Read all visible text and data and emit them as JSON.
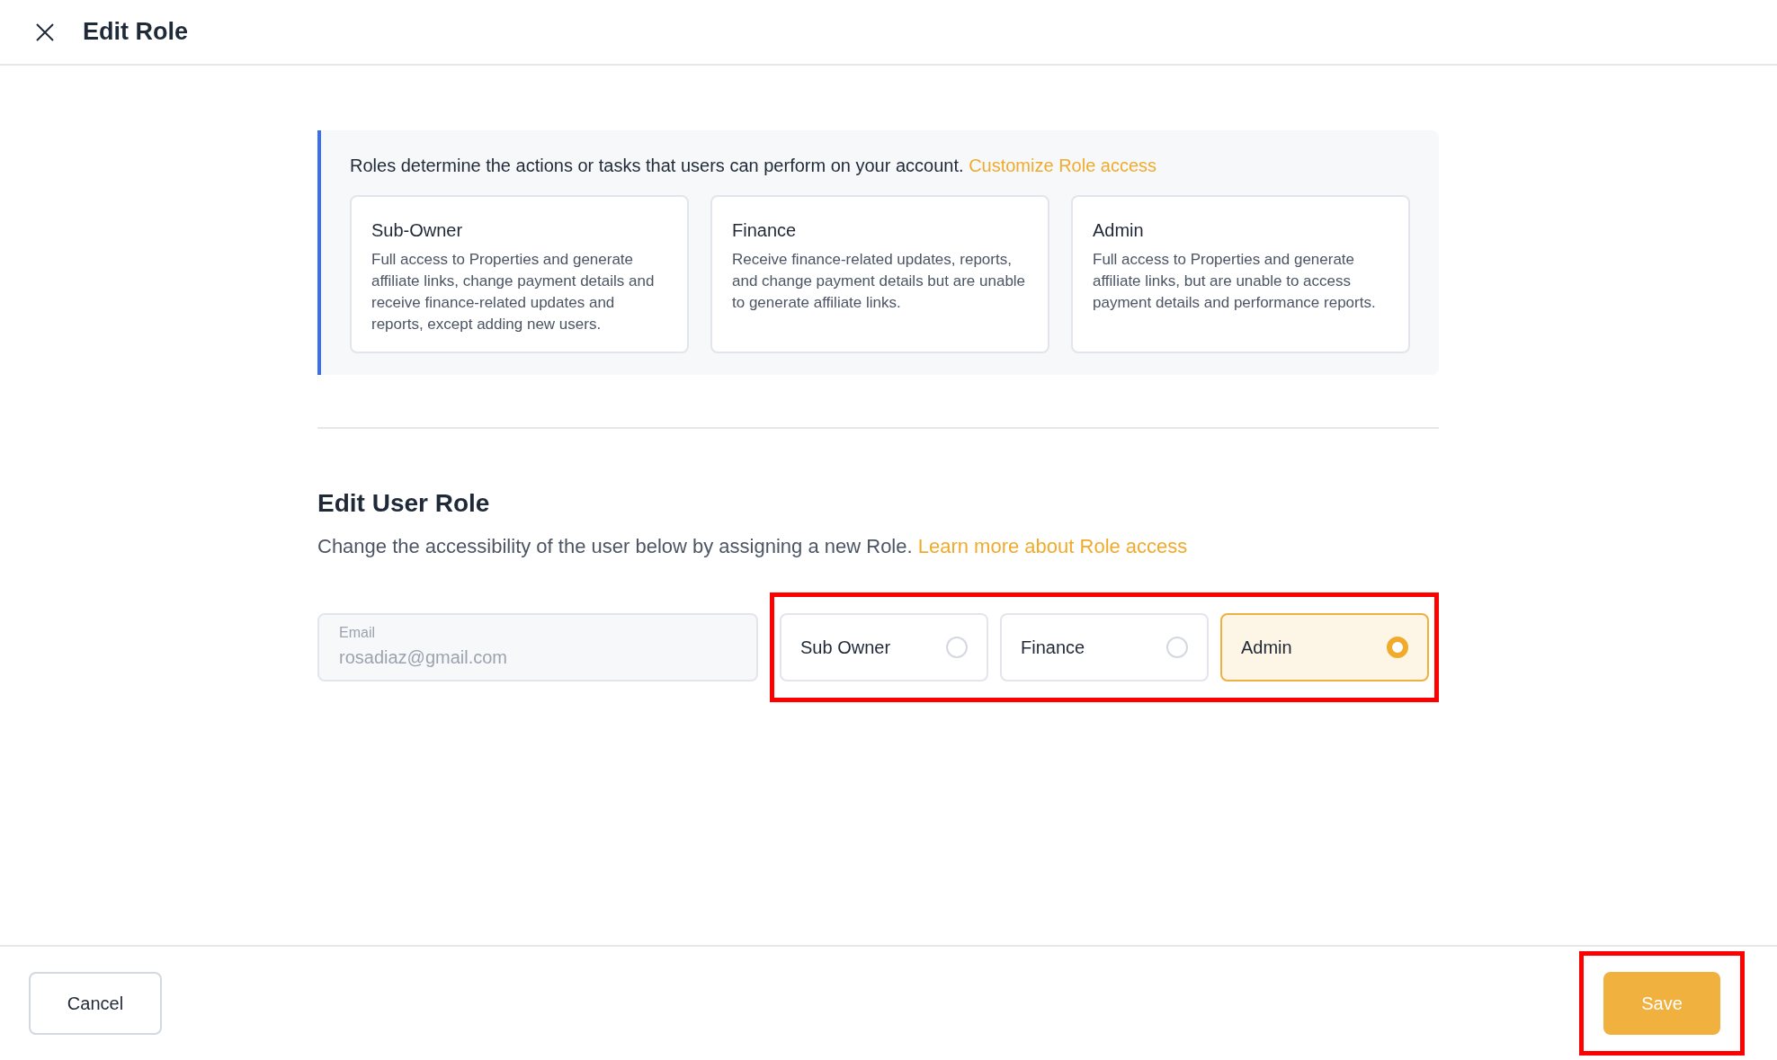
{
  "header": {
    "title": "Edit Role"
  },
  "info": {
    "text": "Roles determine the actions or tasks that users can perform on your account.",
    "link": "Customize Role access",
    "cards": [
      {
        "title": "Sub-Owner",
        "description": "Full access to Properties and generate affiliate links, change payment details and receive finance-related updates and reports, except adding new users."
      },
      {
        "title": "Finance",
        "description": "Receive finance-related updates, reports, and change payment details but are unable to generate affiliate links."
      },
      {
        "title": "Admin",
        "description": "Full access to Properties and generate affiliate links, but are unable to access payment details and performance reports."
      }
    ]
  },
  "section": {
    "title": "Edit User Role",
    "description": "Change the accessibility of the user below by assigning a new Role.",
    "link": "Learn more about Role access"
  },
  "email": {
    "label": "Email",
    "value": "rosadiaz@gmail.com"
  },
  "roles": [
    {
      "label": "Sub Owner",
      "selected": false
    },
    {
      "label": "Finance",
      "selected": false
    },
    {
      "label": "Admin",
      "selected": true
    }
  ],
  "highlight_roles": true,
  "footer": {
    "cancel": "Cancel",
    "save": "Save",
    "highlight_save": true
  }
}
